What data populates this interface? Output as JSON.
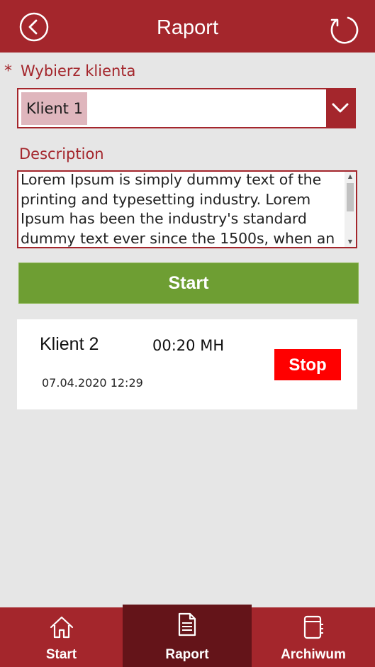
{
  "header": {
    "title": "Raport"
  },
  "form": {
    "required_marker": "*",
    "client_label": "Wybierz klienta",
    "client_selected": "Klient 1",
    "description_label": "Description",
    "description_text": "Lorem Ipsum is simply dummy text of the printing and typesetting industry. Lorem Ipsum has been the industry's standard dummy text ever since the 1500s, when an unknown printer took a galley of type and scrambled it to make a type specimen book.",
    "start_label": "Start"
  },
  "entries": [
    {
      "client": "Klient 2",
      "duration": "00:20 MH",
      "datetime": "07.04.2020 12:29",
      "stop_label": "Stop"
    }
  ],
  "nav": {
    "items": [
      {
        "label": "Start",
        "icon": "home-icon"
      },
      {
        "label": "Raport",
        "icon": "document-icon",
        "active": true
      },
      {
        "label": "Archiwum",
        "icon": "notebook-icon"
      }
    ]
  },
  "colors": {
    "brand": "#a4262c",
    "brand_dark": "#641419",
    "start_green": "#6e9e33",
    "stop_red": "#ff0000",
    "selection_pink": "#dfb6bd",
    "background": "#e6e6e6"
  }
}
